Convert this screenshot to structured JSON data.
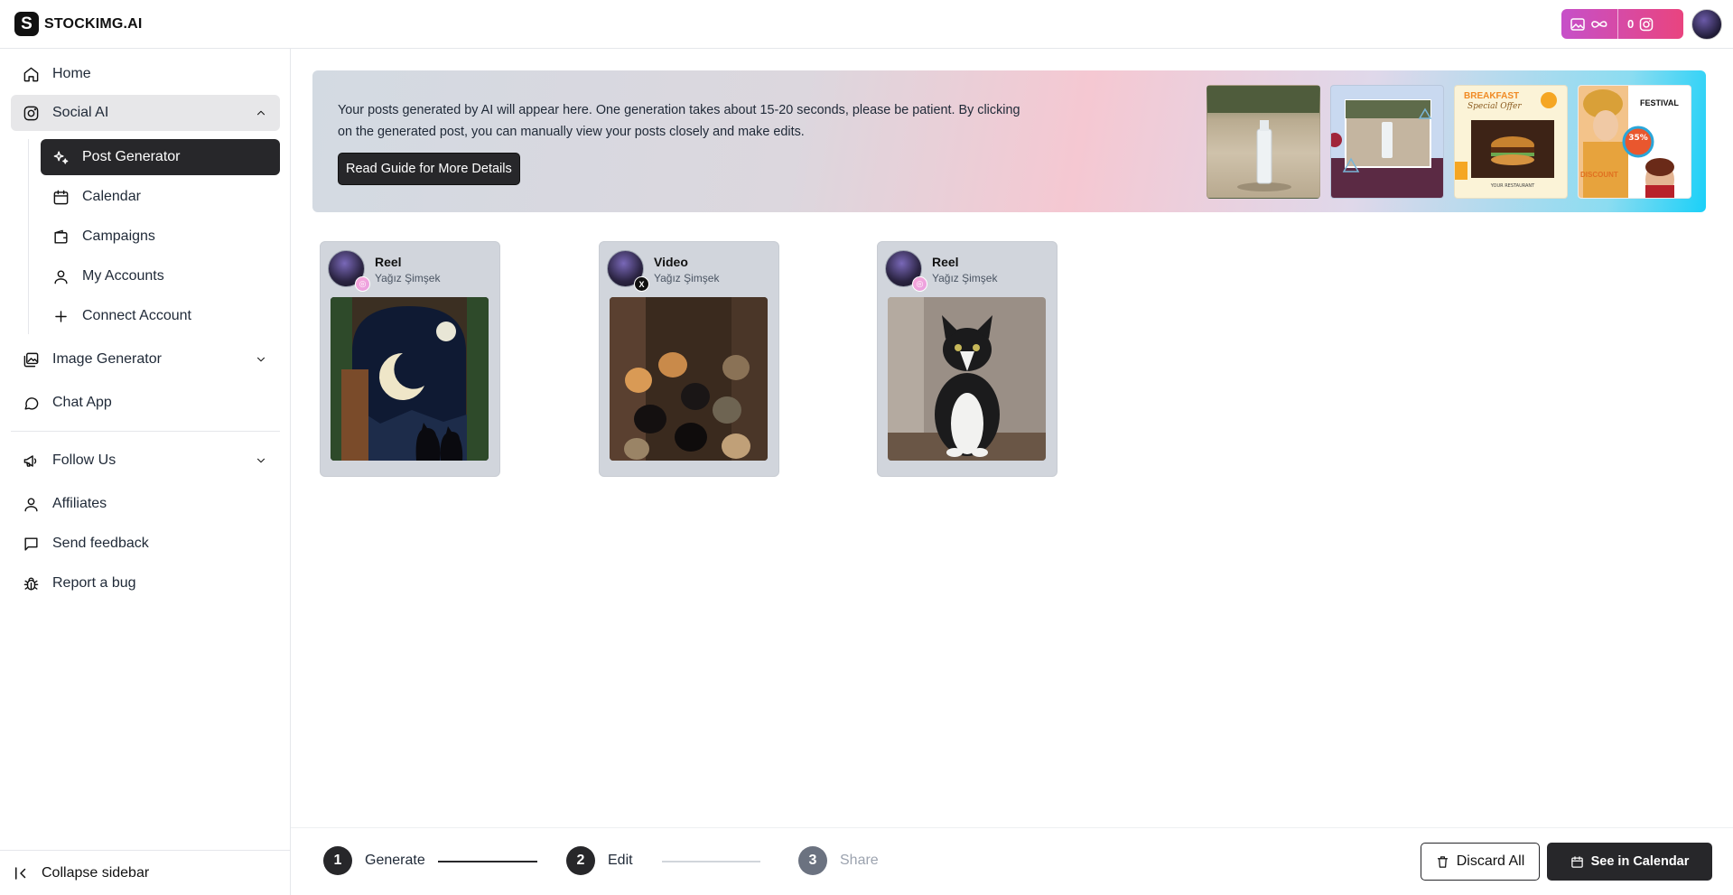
{
  "app": {
    "logo_letter": "S",
    "logo_text": "STOCKIMG.AI",
    "credits_instagram_count": "0"
  },
  "sidebar": {
    "home": "Home",
    "social_ai": "Social AI",
    "post_generator": "Post Generator",
    "calendar": "Calendar",
    "campaigns": "Campaigns",
    "my_accounts": "My Accounts",
    "connect_account": "Connect Account",
    "image_generator": "Image Generator",
    "chat_app": "Chat App",
    "follow_us": "Follow Us",
    "affiliates": "Affiliates",
    "send_feedback": "Send feedback",
    "report_bug": "Report a bug",
    "collapse": "Collapse sidebar"
  },
  "banner": {
    "text": "Your posts generated by AI will appear here. One generation takes about 15-20 seconds, please be patient. By clicking on the generated post, you can manually view your posts closely and make edits.",
    "guide_button": "Read Guide for More Details",
    "thumb3_title": "BREAKFAST",
    "thumb3_subtitle": "Special Offer",
    "thumb4_title": "FESTIVAL",
    "thumb4_discount": "DISCOUNT"
  },
  "posts": [
    {
      "type": "Reel",
      "user": "Yağız Şimşek",
      "platform": "instagram"
    },
    {
      "type": "Video",
      "user": "Yağız Şimşek",
      "platform": "x"
    },
    {
      "type": "Reel",
      "user": "Yağız Şimşek",
      "platform": "instagram"
    }
  ],
  "stepper": {
    "steps": [
      {
        "num": "1",
        "label": "Generate"
      },
      {
        "num": "2",
        "label": "Edit"
      },
      {
        "num": "3",
        "label": "Share"
      }
    ],
    "discard": "Discard All",
    "see_calendar": "See in Calendar"
  },
  "colors": {
    "primary_dark": "#27272a",
    "credits_gradient_start": "#c650c9",
    "credits_gradient_end": "#e9447f",
    "banner_accent": "#1ad0f8"
  }
}
